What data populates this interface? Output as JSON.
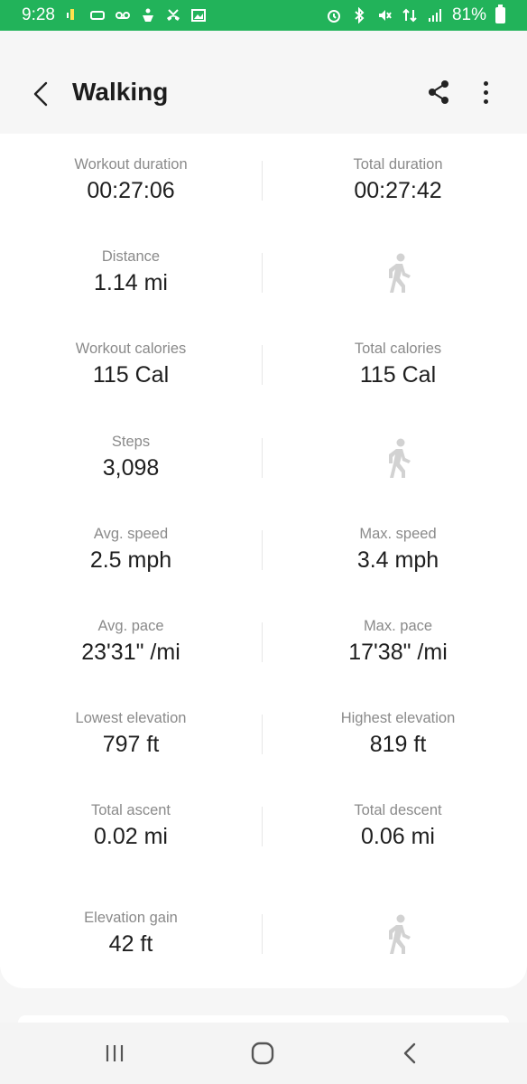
{
  "status_bar": {
    "time": "9:28",
    "battery_percent": "81%",
    "left_icons": [
      "android-debug-icon",
      "sync-icon",
      "voicemail-icon",
      "accessibility-icon",
      "missed-call-icon",
      "image-icon"
    ],
    "right_icons": [
      "alarm-icon",
      "bluetooth-icon",
      "mute-icon",
      "data-icon",
      "signal-icon",
      "battery-icon"
    ]
  },
  "header": {
    "title": "Walking"
  },
  "stats": [
    {
      "left": {
        "label": "Workout duration",
        "value": "00:27:06"
      },
      "right": {
        "label": "Total duration",
        "value": "00:27:42"
      }
    },
    {
      "left": {
        "label": "Distance",
        "value": "1.14 mi"
      },
      "right": null
    },
    {
      "left": {
        "label": "Workout calories",
        "value": "115 Cal"
      },
      "right": {
        "label": "Total calories",
        "value": "115 Cal"
      }
    },
    {
      "left": {
        "label": "Steps",
        "value": "3,098"
      },
      "right": null
    },
    {
      "left": {
        "label": "Avg. speed",
        "value": "2.5 mph"
      },
      "right": {
        "label": "Max. speed",
        "value": "3.4 mph"
      }
    },
    {
      "left": {
        "label": "Avg. pace",
        "value": "23'31\" /mi"
      },
      "right": {
        "label": "Max. pace",
        "value": "17'38\" /mi"
      }
    },
    {
      "left": {
        "label": "Lowest elevation",
        "value": "797 ft"
      },
      "right": {
        "label": "Highest elevation",
        "value": "819 ft"
      }
    },
    {
      "left": {
        "label": "Total ascent",
        "value": "0.02 mi"
      },
      "right": {
        "label": "Total descent",
        "value": "0.06 mi"
      }
    },
    {
      "left": {
        "label": "Elevation gain",
        "value": "42 ft"
      },
      "right": null
    }
  ],
  "colors": {
    "status_bar": "#22b35a",
    "label": "#8a8a8a",
    "value": "#1e1e1e",
    "walker_icon": "#d2d2d2"
  }
}
